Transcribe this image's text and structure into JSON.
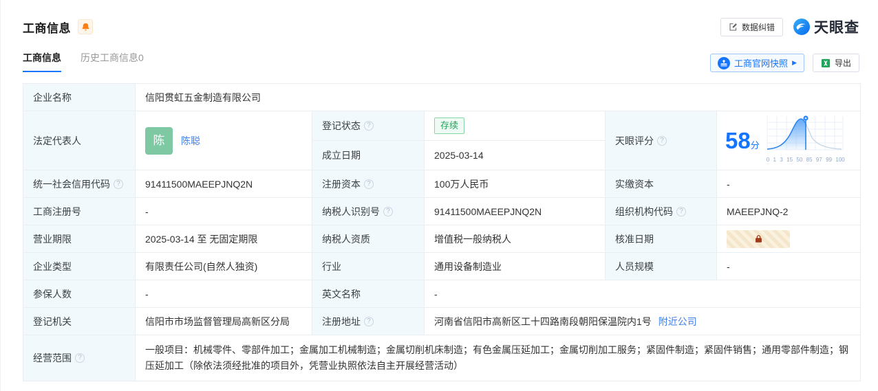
{
  "colors": {
    "accent_blue": "#1675FF",
    "link_blue": "#3D7FEC",
    "tag_green": "#21A35D",
    "avatar_green": "#7EC8A3",
    "bell_orange": "#FF7E14",
    "excel_green": "#21A35B",
    "lock_rust": "#9C3D1E",
    "label_bg": "#F2F9FC"
  },
  "header": {
    "title": "工商信息",
    "data_correction": "数据纠错",
    "brand": "天眼查",
    "tabs": [
      {
        "label": "工商信息",
        "active": true
      },
      {
        "label": "历史工商信息0",
        "active": false
      }
    ],
    "snapshot": "工商官网快照",
    "snapshot_arrow": "▶",
    "export": "导出"
  },
  "table": {
    "company_name": {
      "label": "企业名称",
      "value": "信阳贯虹五金制造有限公司"
    },
    "legal_rep": {
      "label": "法定代表人",
      "avatar": "陈",
      "name": "陈聪"
    },
    "reg_status": {
      "label": "登记状态",
      "value": "存续"
    },
    "est_date": {
      "label": "成立日期",
      "value": "2025-03-14"
    },
    "score": {
      "label": "天眼评分",
      "value": "58",
      "unit": "分"
    },
    "credit_code": {
      "label": "统一社会信用代码",
      "value": "91411500MAEEPJNQ2N"
    },
    "reg_capital": {
      "label": "注册资本",
      "value": "100万人民币"
    },
    "paid_capital": {
      "label": "实缴资本",
      "value": "-"
    },
    "reg_number": {
      "label": "工商注册号",
      "value": "-"
    },
    "taxpayer_id": {
      "label": "纳税人识别号",
      "value": "91411500MAEEPJNQ2N"
    },
    "org_code": {
      "label": "组织机构代码",
      "value": "MAEEPJNQ-2"
    },
    "business_term": {
      "label": "营业期限",
      "value": "2025-03-14 至 无固定期限"
    },
    "taxpayer_quality": {
      "label": "纳税人资质",
      "value": "增值税一般纳税人"
    },
    "approved_date": {
      "label": "核准日期"
    },
    "company_type": {
      "label": "企业类型",
      "value": "有限责任公司(自然人独资)"
    },
    "industry": {
      "label": "行业",
      "value": "通用设备制造业"
    },
    "staff_size": {
      "label": "人员规模",
      "value": "-"
    },
    "insured_count": {
      "label": "参保人数",
      "value": "-"
    },
    "english_name": {
      "label": "英文名称",
      "value": "-"
    },
    "reg_authority": {
      "label": "登记机关",
      "value": "信阳市市场监督管理局高新区分局"
    },
    "reg_address": {
      "label": "注册地址",
      "value": "河南省信阳市高新区工十四路南段朝阳保温院内1号",
      "link": "附近公司"
    },
    "business_scope": {
      "label": "经营范围",
      "value": "一般项目：机械零件、零部件加工；金属加工机械制造；金属切削机床制造；有色金属压延加工；金属切削加工服务；紧固件制造；紧固件销售；通用零部件制造；钢压延加工（除依法须经批准的项目外，凭营业执照依法自主开展经营活动）"
    }
  },
  "chart_data": {
    "type": "area",
    "title": "天眼评分",
    "score": 58,
    "unit": "分",
    "x_ticks": [
      "0",
      "1",
      "3",
      "15",
      "50",
      "85",
      "97",
      "99",
      "100"
    ],
    "xlim": [
      0,
      100
    ],
    "marker_x": 58,
    "description": "score percentile bell curve, blue-filled up to the company score marker, grid on, ticks are normal-distribution percentiles"
  }
}
